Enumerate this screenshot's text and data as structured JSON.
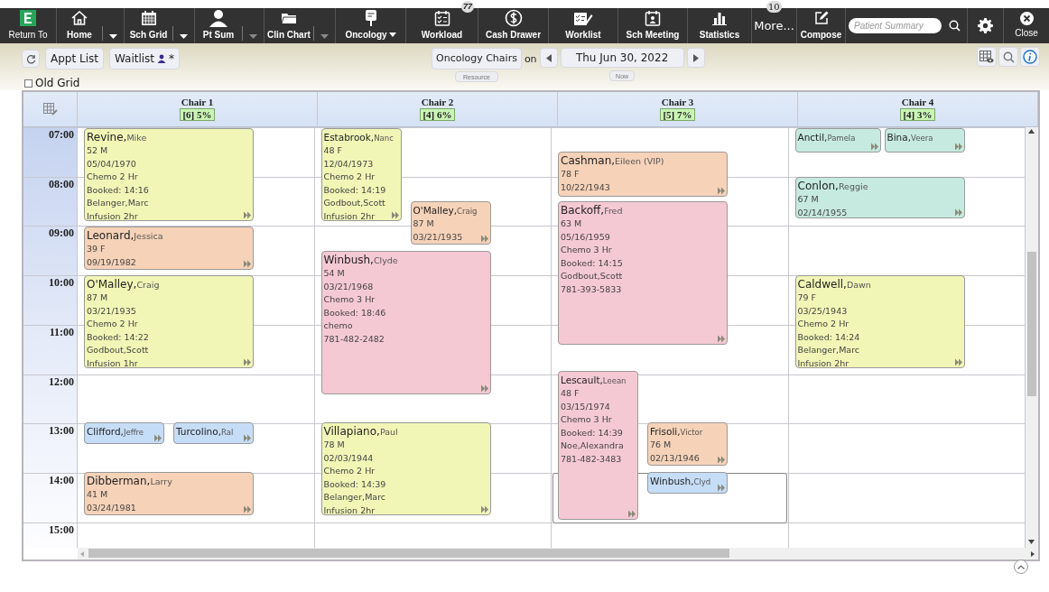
{
  "toolbar": {
    "items": [
      {
        "label": "Return To"
      },
      {
        "label": "Home",
        "kind": "split-menu",
        "menu_disabled": false
      },
      {
        "label": "Sch Grid",
        "kind": "split-menu",
        "menu_disabled": false
      },
      {
        "label": "Pt Sum",
        "kind": "split-menu",
        "menu_disabled": true
      },
      {
        "label": "Clin Chart",
        "kind": "split-menu",
        "menu_disabled": true
      },
      {
        "label": "Oncology",
        "kind": "inline-menu"
      },
      {
        "label": "Workload",
        "badge": "77"
      },
      {
        "label": "Cash Drawer"
      },
      {
        "label": "Worklist"
      },
      {
        "label": "Sch Meeting"
      },
      {
        "label": "Statistics"
      },
      {
        "label": "More...",
        "badge": "10"
      },
      {
        "label": "Compose"
      }
    ],
    "search": {
      "placeholder": "Patient Summary"
    },
    "close": "Close"
  },
  "nav": {
    "appt_list": "Appt List",
    "waitlist": {
      "label": "Waitlist",
      "suffix": "*"
    },
    "resource": "Oncology Chairs",
    "resource_hint": "Resource",
    "on": "on",
    "date": "Thu Jun 30, 2022",
    "now": "Now"
  },
  "old_grid": {
    "label": "Old Grid",
    "checked": false
  },
  "hours": [
    "07:00",
    "08:00",
    "09:00",
    "10:00",
    "11:00",
    "12:00",
    "13:00",
    "14:00",
    "15:00"
  ],
  "chairs": [
    {
      "name": "Chair 1",
      "stats": "[6] 5%",
      "slots": [
        {
          "selected": false
        },
        {
          "selected": false
        },
        {
          "selected": false
        },
        {
          "selected": false
        },
        {
          "selected": false
        },
        {
          "selected": false
        },
        {
          "selected": false
        },
        {
          "selected": false
        },
        {
          "selected": false
        }
      ],
      "appointments": [
        {
          "last": "Revine,",
          "first": "Mike",
          "color": "#f1f6b6",
          "lines": [
            "52 M",
            "05/04/1970",
            "Chemo 2 Hr",
            "Booked: 14:16",
            "Belanger,Marc",
            "Infusion 2hr"
          ]
        },
        {
          "last": "Leonard,",
          "first": "Jessica",
          "color": "#f6d2b8",
          "lines": [
            "39 F",
            "09/19/1982"
          ]
        },
        {
          "last": "O'Malley,",
          "first": "Craig",
          "color": "#f1f6b6",
          "lines": [
            "87 M",
            "03/21/1935",
            "Chemo 2 Hr",
            "Booked: 14:22",
            "Godbout,Scott",
            "Infusion 1hr"
          ]
        },
        {
          "last": "Clifford,",
          "first": "Jeffre",
          "color": "#c6ddf7"
        },
        {
          "last": "Turcolino,",
          "first": "Ral",
          "color": "#c6ddf7"
        },
        {
          "last": "Dibberman,",
          "first": "Larry",
          "color": "#f6d2b8",
          "lines": [
            "41 M",
            "03/24/1981"
          ]
        }
      ]
    },
    {
      "name": "Chair 2",
      "stats": "[4] 6%",
      "slots": [
        {
          "selected": false
        },
        {
          "selected": false
        },
        {
          "selected": false
        },
        {
          "selected": false
        },
        {
          "selected": false
        },
        {
          "selected": false
        },
        {
          "selected": false
        },
        {
          "selected": false
        },
        {
          "selected": false
        }
      ],
      "appointments": [
        {
          "last": "Estabrook,",
          "first": "Nanc",
          "color": "#f1f6b6",
          "lines": [
            "48 F",
            "12/04/1973",
            "Chemo 2 Hr",
            "Booked: 14:19",
            "Godbout,Scott",
            "Infusion 2hr"
          ]
        },
        {
          "last": "O'Malley,",
          "first": "Craig",
          "color": "#f6d2b8",
          "lines": [
            "87 M",
            "03/21/1935"
          ]
        },
        {
          "last": "Winbush,",
          "first": "Clyde",
          "color": "#f5c9d4",
          "lines": [
            "54 M",
            "03/21/1968",
            "Chemo 3 Hr",
            "Booked: 18:46",
            "chemo",
            "781-482-2482"
          ]
        },
        {
          "last": "Villapiano,",
          "first": "Paul",
          "color": "#f1f6b6",
          "lines": [
            "78 M",
            "02/03/1944",
            "Chemo 2 Hr",
            "Booked: 14:39",
            "Belanger,Marc",
            "Infusion 2hr"
          ]
        }
      ]
    },
    {
      "name": "Chair 3",
      "stats": "[5] 7%",
      "slots": [
        {
          "selected": false
        },
        {
          "selected": false
        },
        {
          "selected": false
        },
        {
          "selected": false
        },
        {
          "selected": false
        },
        {
          "selected": false
        },
        {
          "selected": false
        },
        {
          "selected": true
        },
        {
          "selected": false
        }
      ],
      "appointments": [
        {
          "last": "Cashman,",
          "first": "Eileen (VIP)",
          "color": "#f6d2b8",
          "lines": [
            "78 F",
            "10/22/1943"
          ]
        },
        {
          "last": "Backoff,",
          "first": "Fred",
          "color": "#f5c9d4",
          "lines": [
            "63 M",
            "05/16/1959",
            "Chemo 3 Hr",
            "Booked: 14:15",
            "Godbout,Scott",
            "781-393-5833"
          ]
        },
        {
          "last": "Lescault,",
          "first": "Leean",
          "color": "#f5c9d4",
          "lines": [
            "48 F",
            "03/15/1974",
            "Chemo 3 Hr",
            "Booked: 14:39",
            "Noe,Alexandra",
            "781-482-3483"
          ]
        },
        {
          "last": "Frisoli,",
          "first": "Victor",
          "color": "#f6d2b8",
          "lines": [
            "76 M",
            "02/13/1946"
          ]
        },
        {
          "last": "Winbush,",
          "first": "Clyd",
          "color": "#c6ddf7"
        }
      ]
    },
    {
      "name": "Chair 4",
      "stats": "[4] 3%",
      "slots": [
        {
          "selected": false
        },
        {
          "selected": false
        },
        {
          "selected": false
        },
        {
          "selected": false
        },
        {
          "selected": false
        },
        {
          "selected": false
        },
        {
          "selected": false
        },
        {
          "selected": false
        },
        {
          "selected": false
        }
      ],
      "appointments": [
        {
          "last": "Anctil,",
          "first": "Pamela",
          "color": "#c6eadf"
        },
        {
          "last": "Bina,",
          "first": "Veera",
          "color": "#c6eadf"
        },
        {
          "last": "Conlon,",
          "first": "Reggie",
          "color": "#c6eadf",
          "lines": [
            "67 M",
            "02/14/1955"
          ]
        },
        {
          "last": "Caldwell,",
          "first": "Dawn",
          "color": "#f1f6b6",
          "lines": [
            "79 F",
            "03/25/1943",
            "Chemo 2 Hr",
            "Booked: 14:24",
            "Belanger,Marc",
            "Infusion 2hr"
          ]
        }
      ]
    }
  ]
}
